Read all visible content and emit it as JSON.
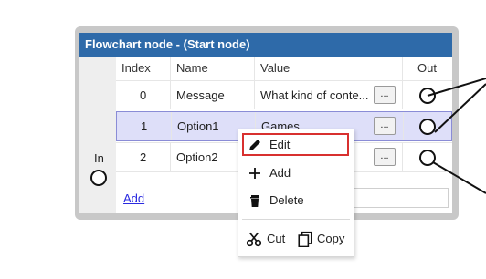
{
  "node": {
    "title": "Flowchart node - (Start node)",
    "in_label": "In",
    "columns": {
      "index": "Index",
      "name": "Name",
      "value": "Value",
      "out": "Out"
    },
    "rows": [
      {
        "index": "0",
        "name": "Message",
        "value": "What kind of conte...",
        "button": "...",
        "selected": false
      },
      {
        "index": "1",
        "name": "Option1",
        "value": "Games",
        "button": "...",
        "selected": true
      },
      {
        "index": "2",
        "name": "Option2",
        "value": "",
        "button": "...",
        "selected": false
      }
    ],
    "add_link": "Add"
  },
  "context_menu": {
    "edit": "Edit",
    "add": "Add",
    "delete": "Delete",
    "cut": "Cut",
    "copy": "Copy",
    "icons": {
      "edit": "pencil-icon",
      "add": "plus-icon",
      "delete": "trash-icon",
      "cut": "scissors-icon",
      "copy": "copy-icon"
    }
  },
  "colors": {
    "title_bar": "#2e6aa9",
    "selection": "#dedff9",
    "highlight_border": "#d8302f",
    "link": "#2a2ae0"
  }
}
